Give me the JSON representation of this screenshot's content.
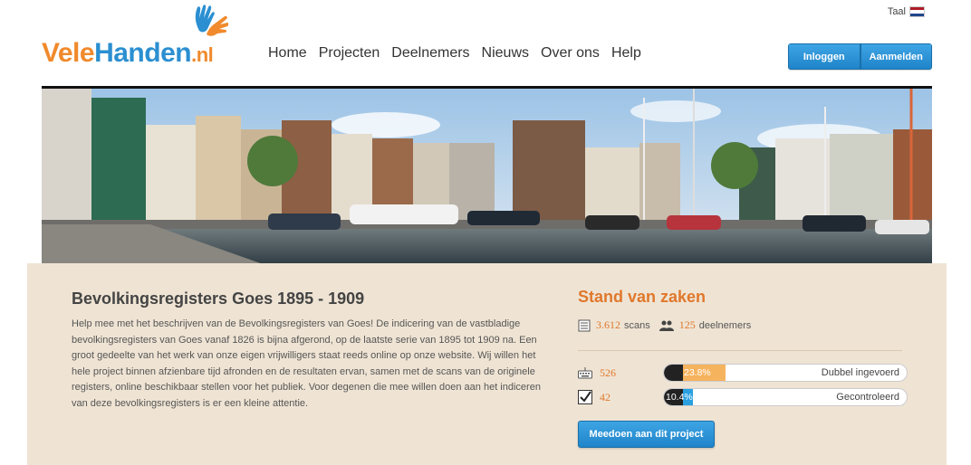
{
  "logo": {
    "vele": "Vele",
    "handen": "Handen",
    "nl": ".nl"
  },
  "nav": [
    "Home",
    "Projecten",
    "Deelnemers",
    "Nieuws",
    "Over ons",
    "Help"
  ],
  "language": {
    "label": "Taal",
    "flag": "netherlands-flag"
  },
  "auth": {
    "login": "Inloggen",
    "register": "Aanmelden"
  },
  "hero": {
    "image": "harbour-town-photo"
  },
  "project": {
    "title": "Bevolkingsregisters Goes 1895 - 1909",
    "description": "Help mee met het beschrijven van de Bevolkingsregisters van Goes! De indicering van de vastbladige bevolkingsregisters van Goes vanaf 1826 is bijna afgerond, op de laatste serie van 1895 tot 1909 na. Een groot gedeelte van het werk van onze eigen vrijwilligers staat reeds online op onze website. Wij willen het hele project binnen afzienbare tijd afronden en de resultaten ervan, samen met de scans van de originele registers, online beschikbaar stellen voor het publiek. Voor degenen die mee willen doen aan het indiceren van deze bevolkingsregisters is er een kleine attentie."
  },
  "status": {
    "title": "Stand van zaken",
    "scans_count": "3.612",
    "scans_label": "scans",
    "participants_count": "125",
    "participants_label": "deelnemers",
    "rows": [
      {
        "icon": "keyboard-icon",
        "count": "526",
        "percent_label": "23.8%",
        "percent": 23.8,
        "label": "Dubbel ingevoerd",
        "fill_color": "#f6b35e"
      },
      {
        "icon": "checkbox-icon",
        "count": "42",
        "percent_label": "10.4%",
        "percent": 10.4,
        "label": "Gecontroleerd",
        "fill_color": "#2aa0e0"
      }
    ],
    "join_button": "Meedoen aan dit project"
  },
  "colors": {
    "accent": "#e0782c",
    "primary": "#2b8fd1",
    "panel": "#efe4d4"
  }
}
